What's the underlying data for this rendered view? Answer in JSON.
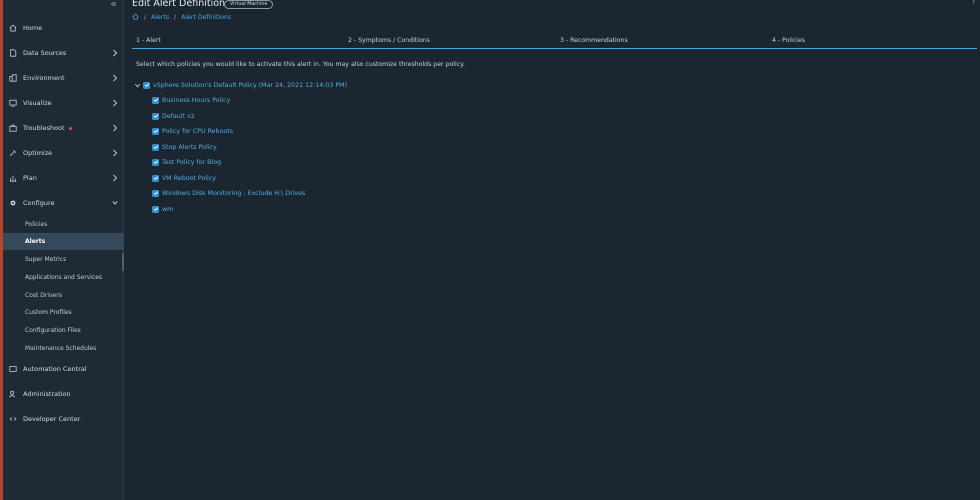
{
  "sidebar": {
    "items": [
      {
        "label": "Home",
        "icon": "home-icon"
      },
      {
        "label": "Data Sources",
        "icon": "data-sources-icon"
      },
      {
        "label": "Environment",
        "icon": "environment-icon"
      },
      {
        "label": "Visualize",
        "icon": "visualize-icon"
      },
      {
        "label": "Troubleshoot",
        "icon": "troubleshoot-icon"
      },
      {
        "label": "Optimize",
        "icon": "optimize-icon"
      },
      {
        "label": "Plan",
        "icon": "plan-icon"
      },
      {
        "label": "Configure",
        "icon": "configure-icon"
      }
    ],
    "configure_items": [
      "Policies",
      "Alerts",
      "Super Metrics",
      "Applications and Services",
      "Cost Drivers",
      "Custom Profiles",
      "Configuration Files",
      "Maintenance Schedules"
    ],
    "bottom_items": [
      {
        "label": "Automation Central",
        "icon": "automation-icon"
      },
      {
        "label": "Administration",
        "icon": "administration-icon"
      },
      {
        "label": "Developer Center",
        "icon": "developer-center-icon"
      }
    ]
  },
  "header": {
    "title": "Edit Alert Definition",
    "badge": "Virtual Machine",
    "help": "?",
    "breadcrumb": [
      "Alerts",
      "Alert Definitions"
    ]
  },
  "steps": [
    "1 - Alert",
    "2 - Symptoms / Conditions",
    "3 - Recommendations",
    "4 - Policies"
  ],
  "intro": "Select which policies you would like to activate this alert in. You may also customize thresholds per policy.",
  "policy_tree": {
    "root": "vSphere Solution's Default Policy (Mar 24, 2021 12:14:03 PM)",
    "children": [
      "Business Hours Policy",
      "Default v2",
      "Policy for CPU Reboots",
      "Stop Alerts Policy",
      "Test Policy for Blog",
      "VM Reboot Policy",
      "Windows Disk Monitoring - Exclude H:\\ Drives",
      "wm"
    ]
  },
  "colors": {
    "accent": "#4aa3df",
    "sidebar_bg": "#1e2a35",
    "main_bg": "#1b2631",
    "active_item_bg": "#35495b",
    "status_dot": "#e0533c"
  }
}
